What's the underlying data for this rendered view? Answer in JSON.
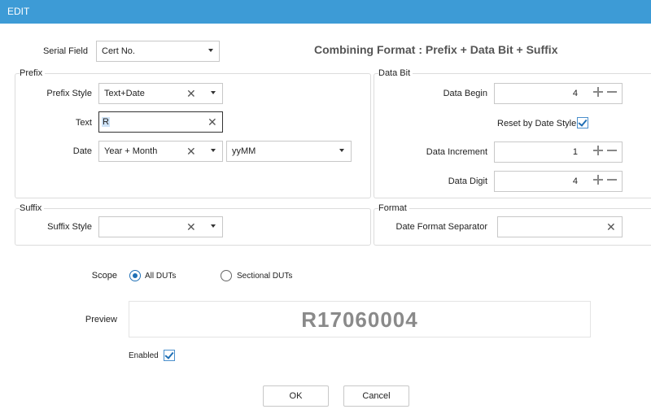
{
  "window": {
    "title": "EDIT"
  },
  "header": {
    "combining_format": "Combining Format : Prefix + Data Bit + Suffix"
  },
  "serial_field": {
    "label": "Serial Field",
    "value": "Cert No."
  },
  "prefix": {
    "title": "Prefix",
    "style_label": "Prefix Style",
    "style_value": "Text+Date",
    "text_label": "Text",
    "text_value": "R",
    "date_label": "Date",
    "date_value": "Year + Month",
    "date_format": "yyMM"
  },
  "suffix": {
    "title": "Suffix",
    "style_label": "Suffix Style",
    "style_value": ""
  },
  "data_bit": {
    "title": "Data Bit",
    "begin_label": "Data Begin",
    "begin_value": "4",
    "reset_label": "Reset by Date Style",
    "reset_checked": true,
    "increment_label": "Data Increment",
    "increment_value": "1",
    "digit_label": "Data Digit",
    "digit_value": "4"
  },
  "format": {
    "title": "Format",
    "separator_label": "Date Format Separator",
    "separator_value": ""
  },
  "scope": {
    "label": "Scope",
    "option_all": "All DUTs",
    "option_sectional": "Sectional DUTs",
    "selected": "All DUTs"
  },
  "preview": {
    "label": "Preview",
    "value": "R17060004"
  },
  "enabled": {
    "label": "Enabled",
    "checked": true
  },
  "buttons": {
    "ok": "OK",
    "cancel": "Cancel"
  },
  "icons": {
    "clear": "close-icon",
    "dropdown": "chevron-down-icon",
    "increase": "plus-icon",
    "decrease": "minus-icon",
    "check": "check-icon"
  },
  "colors": {
    "titlebar": "#3d9bd6",
    "accent": "#1f6fb5",
    "preview_text": "#8a8a8a"
  }
}
